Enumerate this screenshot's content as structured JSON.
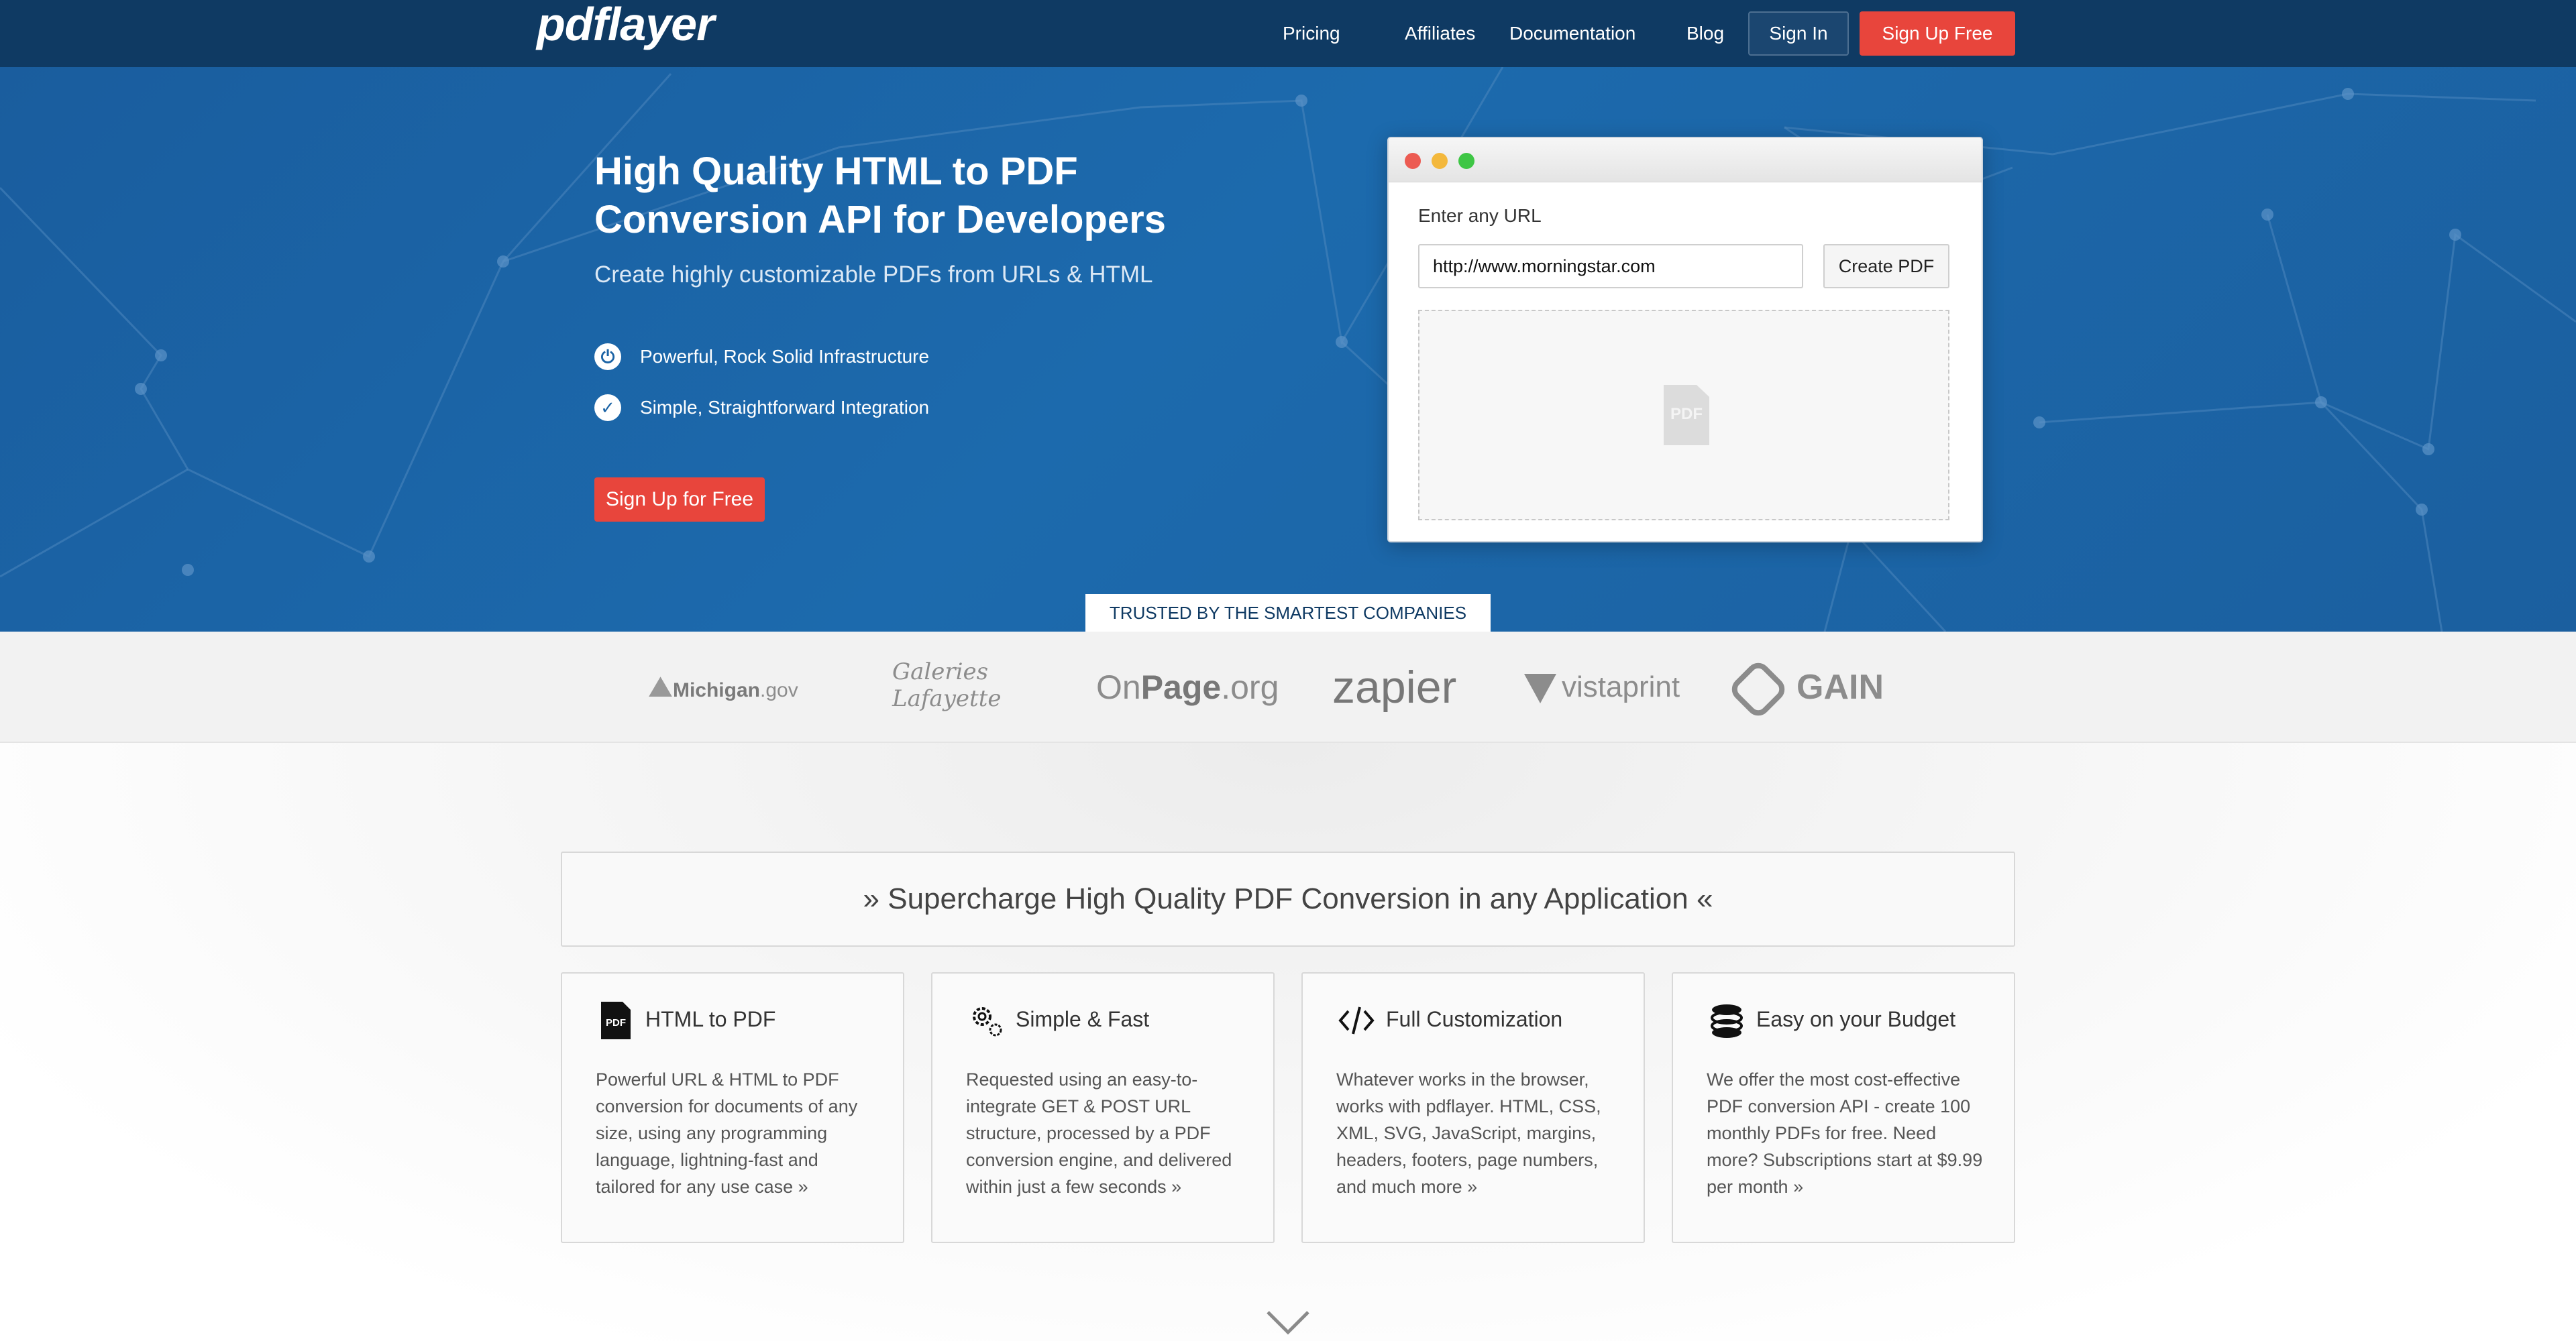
{
  "header": {
    "logo": "pdflayer",
    "nav": [
      "Pricing",
      "Affiliates",
      "Documentation",
      "Blog"
    ],
    "signin": "Sign In",
    "signup": "Sign Up Free"
  },
  "hero": {
    "title_line1": "High Quality HTML to PDF",
    "title_line2": "Conversion API for Developers",
    "subtitle": "Create highly customizable PDFs from URLs & HTML",
    "features": [
      {
        "icon": "plug-icon",
        "text": "Powerful, Rock Solid Infrastructure"
      },
      {
        "icon": "check-circle-icon",
        "text": "Simple, Straightforward Integration"
      }
    ],
    "cta": "Sign Up for Free"
  },
  "demo": {
    "label": "Enter any URL",
    "url_value": "http://www.morningstar.com",
    "button": "Create PDF",
    "placeholder_icon": "PDF",
    "window_dots": [
      "#ec5b52",
      "#f3b83c",
      "#3ec645"
    ]
  },
  "trusted": {
    "heading": "TRUSTED BY THE SMARTEST COMPANIES",
    "logos": {
      "michigan_prefix": "Michigan",
      "michigan_suffix": ".gov",
      "galeries": "Galeries Lafayette",
      "onpage_a": "On",
      "onpage_b": "Page",
      "onpage_c": ".org",
      "zapier": "zapier",
      "vistaprint": "vistaprint",
      "gain": "GAIN"
    }
  },
  "features_section": {
    "banner": "» Supercharge High Quality PDF Conversion in any Application «",
    "cards": [
      {
        "icon": "pdf-file-icon",
        "title": "HTML to PDF",
        "body": "Powerful URL & HTML to PDF conversion for documents of any size, using any programming language, lightning-fast and tailored for any use case »"
      },
      {
        "icon": "gears-icon",
        "title": "Simple & Fast",
        "body": "Requested using an easy-to-integrate GET & POST URL structure, processed by a PDF conversion engine, and delivered within just a few seconds »"
      },
      {
        "icon": "code-icon",
        "title": "Full Customization",
        "body": "Whatever works in the browser, works with pdflayer. HTML, CSS, XML, SVG, JavaScript, margins, headers, footers, page numbers, and much more »"
      },
      {
        "icon": "coins-icon",
        "title": "Easy on your Budget",
        "body": "We offer the most cost-effective PDF conversion API - create 100 monthly PDFs for free. Need more? Subscriptions start at $9.99 per month »"
      }
    ]
  },
  "colors": {
    "header_bg": "#0f3a63",
    "hero_bg": "#1c64a6",
    "accent_red": "#e8453c"
  }
}
